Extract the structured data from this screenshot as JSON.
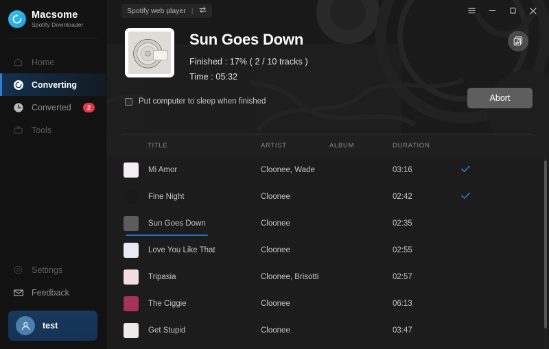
{
  "brand": {
    "name": "Macsome",
    "subtitle": "Spotify Downloader",
    "logo_icon": "refresh-circle-icon",
    "accent": "#2a7fd4"
  },
  "sidebar": {
    "items": [
      {
        "label": "Home",
        "icon": "home-icon",
        "active": false,
        "dim": true
      },
      {
        "label": "Converting",
        "icon": "convert-circle-icon",
        "active": true,
        "dim": false
      },
      {
        "label": "Converted",
        "icon": "clock-icon",
        "active": false,
        "dim": false,
        "badge": "2"
      },
      {
        "label": "Tools",
        "icon": "toolbox-icon",
        "active": false,
        "dim": true
      }
    ],
    "bottom_items": [
      {
        "label": "Settings",
        "icon": "gear-icon",
        "dim": true
      },
      {
        "label": "Feedback",
        "icon": "mail-icon",
        "dim": false
      }
    ],
    "account": {
      "name": "test",
      "icon": "user-avatar-icon"
    },
    "badge_color": "#e8394a"
  },
  "titlebar": {
    "web_player_label": "Spotify web player",
    "swap_icon": "swap-arrows-icon",
    "menu_icon": "hamburger-menu-icon",
    "minimize_icon": "minimize-icon",
    "maximize_icon": "maximize-icon",
    "close_icon": "close-icon"
  },
  "hero": {
    "cover_icon": "album-cover-art",
    "title": "Sun Goes Down",
    "progress_line": "Finished : 17% ( 2 / 10 tracks )",
    "time_line": "Time : 05:32",
    "progress_percent": 17,
    "tracks_done": 2,
    "tracks_total": 10,
    "elapsed": "05:32",
    "sleep_label": "Put computer to sleep when finished",
    "sleep_checked": false,
    "abort_label": "Abort",
    "art_toggle_icon": "album-art-toggle-icon"
  },
  "table": {
    "headers": {
      "title": "TITLE",
      "artist": "ARTIST",
      "album": "ALBUM",
      "duration": "DURATION"
    },
    "rows": [
      {
        "title": "Mi Amor",
        "artist": "Cloonee, Wade",
        "album": "",
        "duration": "03:16",
        "done": true,
        "progress": 0,
        "thumb": "#f3eef4"
      },
      {
        "title": "Fine Night",
        "artist": "Cloonee",
        "album": "",
        "duration": "02:42",
        "done": true,
        "progress": 0,
        "thumb": "#1a1a1a"
      },
      {
        "title": "Sun Goes Down",
        "artist": "Cloonee",
        "album": "",
        "duration": "02:35",
        "done": false,
        "progress": 100,
        "thumb": "#5c5c5c"
      },
      {
        "title": "Love You Like That",
        "artist": "Cloonee",
        "album": "",
        "duration": "02:55",
        "done": false,
        "progress": 0,
        "thumb": "#e7e9f4"
      },
      {
        "title": "Tripasia",
        "artist": "Cloonee, Brisotti",
        "album": "",
        "duration": "02:57",
        "done": false,
        "progress": 0,
        "thumb": "#f2dcdf"
      },
      {
        "title": "The Ciggie",
        "artist": "Cloonee",
        "album": "",
        "duration": "06:13",
        "done": false,
        "progress": 0,
        "thumb": "#a53257"
      },
      {
        "title": "Get Stupid",
        "artist": "Cloonee",
        "album": "",
        "duration": "03:47",
        "done": false,
        "progress": 0,
        "thumb": "#f0e9e9"
      }
    ],
    "check_icon": "checkmark-icon",
    "check_color": "#2f7fd6"
  }
}
